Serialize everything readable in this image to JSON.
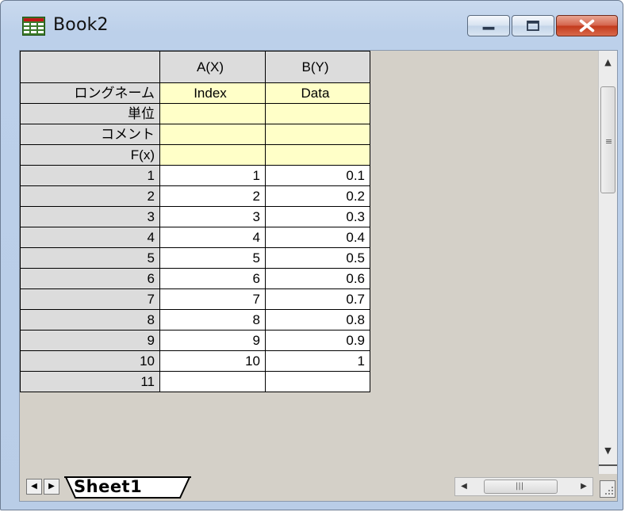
{
  "window": {
    "title": "Book2",
    "icon": "workbook-grid-icon",
    "controls": {
      "minimize": "minimize-icon",
      "maximize": "maximize-icon",
      "close": "close-icon"
    }
  },
  "worksheet": {
    "columns": [
      {
        "header": "A(X)",
        "long_name": "Index",
        "units": "",
        "comment": "",
        "formula": ""
      },
      {
        "header": "B(Y)",
        "long_name": "Data",
        "units": "",
        "comment": "",
        "formula": ""
      }
    ],
    "label_rows": [
      "ロングネーム",
      "単位",
      "コメント",
      "F(x)"
    ],
    "rows": [
      {
        "num": "1",
        "a": "1",
        "b": "0.1"
      },
      {
        "num": "2",
        "a": "2",
        "b": "0.2"
      },
      {
        "num": "3",
        "a": "3",
        "b": "0.3"
      },
      {
        "num": "4",
        "a": "4",
        "b": "0.4"
      },
      {
        "num": "5",
        "a": "5",
        "b": "0.5"
      },
      {
        "num": "6",
        "a": "6",
        "b": "0.6"
      },
      {
        "num": "7",
        "a": "7",
        "b": "0.7"
      },
      {
        "num": "8",
        "a": "8",
        "b": "0.8"
      },
      {
        "num": "9",
        "a": "9",
        "b": "0.9"
      },
      {
        "num": "10",
        "a": "10",
        "b": "1"
      },
      {
        "num": "11",
        "a": "",
        "b": ""
      }
    ]
  },
  "sheet_tabs": {
    "active": "Sheet1"
  },
  "colors": {
    "label_cell": "#ffffc8",
    "header_cell": "#dcdcdc",
    "client_bg": "#d4d0c8",
    "close_button": "#c2391c"
  }
}
